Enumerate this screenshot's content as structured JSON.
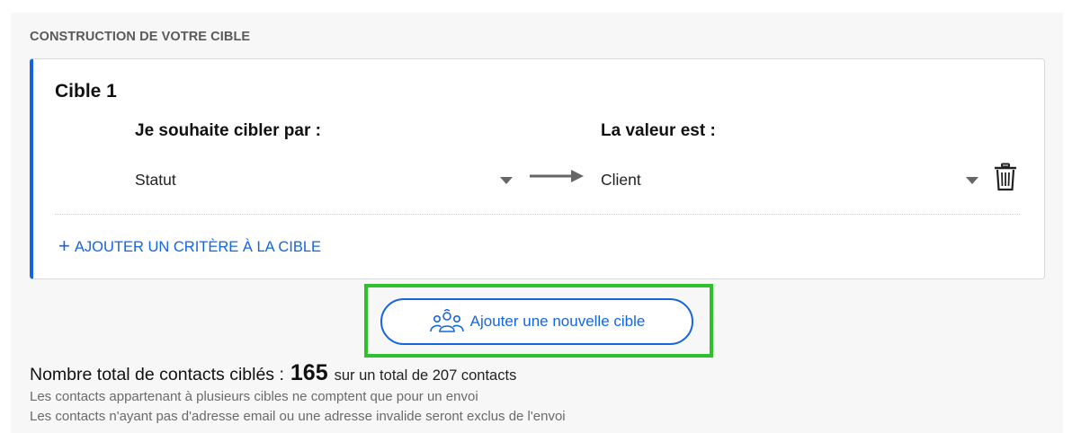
{
  "section": {
    "title": "CONSTRUCTION DE VOTRE CIBLE"
  },
  "target": {
    "title": "Cible 1",
    "criterion_label": "Je souhaite cibler par :",
    "value_label": "La valeur est :",
    "criterion_selected": "Statut",
    "value_selected": "Client",
    "add_criterion_label": "AJOUTER UN CRITÈRE À LA CIBLE"
  },
  "actions": {
    "add_target_label": "Ajouter une nouvelle cible"
  },
  "summary": {
    "label": "Nombre total de contacts ciblés :",
    "count": "165",
    "total_text": "sur un total de 207 contacts",
    "note1": "Les contacts appartenant à plusieurs cibles ne comptent que pour un envoi",
    "note2": "Les contacts n'ayant pas d'adresse email ou une adresse invalide seront exclus de l'envoi"
  },
  "colors": {
    "accent": "#1565e0",
    "highlight": "#2ec12e",
    "panel_bg": "#f7f7f8"
  },
  "icons": {
    "arrow": "arrow-right-icon",
    "delete": "trash-icon",
    "group": "users-group-icon",
    "plus": "plus-icon"
  }
}
